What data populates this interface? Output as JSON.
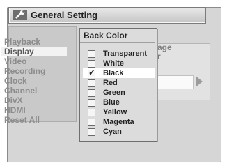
{
  "header": {
    "title": "General Setting",
    "icon": "wrench-icon"
  },
  "menu": {
    "items": [
      {
        "label": "Playback",
        "selected": false
      },
      {
        "label": "Display",
        "selected": true
      },
      {
        "label": "Video",
        "selected": false
      },
      {
        "label": "Recording",
        "selected": false
      },
      {
        "label": "Clock",
        "selected": false
      },
      {
        "label": "Channel",
        "selected": false
      },
      {
        "label": "DivX",
        "selected": false
      },
      {
        "label": "HDMI",
        "selected": false
      },
      {
        "label": "Reset All",
        "selected": false
      }
    ]
  },
  "background_panel": {
    "partial_line1": "age",
    "partial_line2": "r"
  },
  "popup": {
    "title": "Back Color",
    "options": [
      {
        "label": "Transparent",
        "checked": false
      },
      {
        "label": "White",
        "checked": false
      },
      {
        "label": "Black",
        "checked": true
      },
      {
        "label": "Red",
        "checked": false
      },
      {
        "label": "Green",
        "checked": false
      },
      {
        "label": "Blue",
        "checked": false
      },
      {
        "label": "Yellow",
        "checked": false
      },
      {
        "label": "Magenta",
        "checked": false
      },
      {
        "label": "Cyan",
        "checked": false
      }
    ]
  }
}
